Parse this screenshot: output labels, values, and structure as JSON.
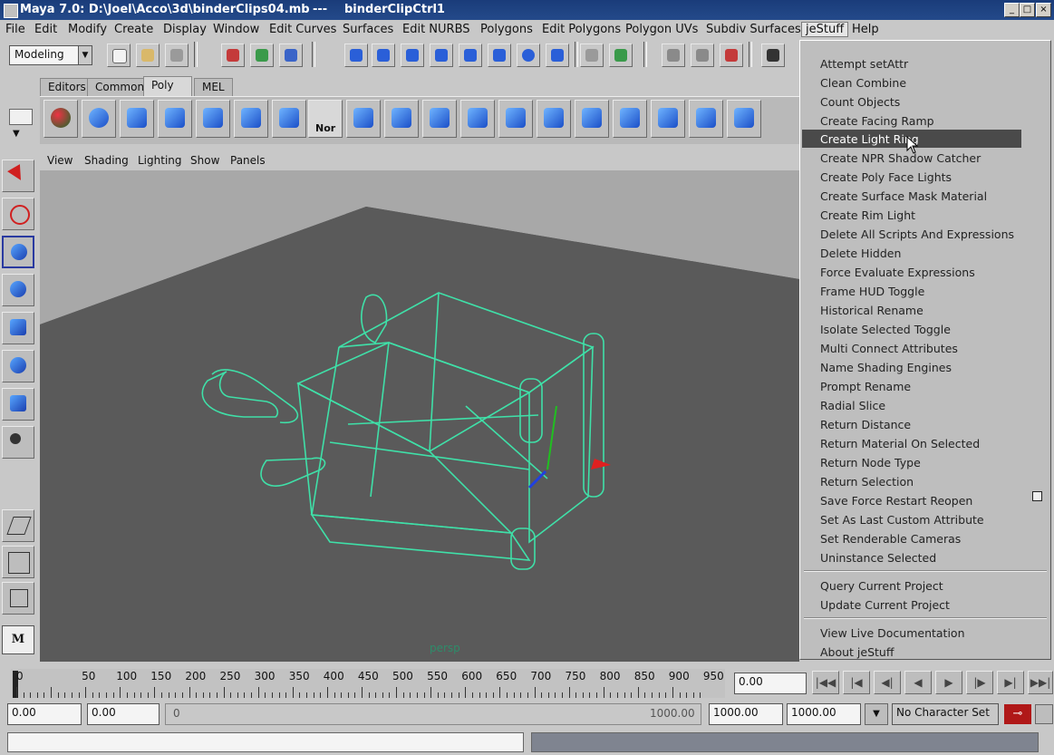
{
  "window": {
    "title": "Maya 7.0: D:\\Joel\\Acco\\3d\\binderClips04.mb",
    "separator": "---",
    "subtitle": "binderClipCtrl1"
  },
  "menubar": [
    "File",
    "Edit",
    "Modify",
    "Create",
    "Display",
    "Window",
    "Edit Curves",
    "Surfaces",
    "Edit NURBS",
    "Polygons",
    "Edit Polygons",
    "Polygon UVs",
    "Subdiv Surfaces",
    "jeStuff",
    "Help"
  ],
  "status": {
    "mode": "Modeling"
  },
  "shelf_tabs": [
    "Editors",
    "Common",
    "Poly",
    "MEL"
  ],
  "shelf_active": "Poly",
  "shelf_nor_label": "Nor",
  "panel_menu": [
    "View",
    "Shading",
    "Lighting",
    "Show",
    "Panels"
  ],
  "viewport": {
    "camera_label": "persp"
  },
  "jestuff_menu": {
    "items_group1": [
      "Attempt setAttr",
      "Clean Combine",
      "Count Objects",
      "Create Facing Ramp",
      "Create Light Ring",
      "Create NPR Shadow Catcher",
      "Create Poly Face Lights",
      "Create Surface Mask Material",
      "Create Rim Light",
      "Delete All Scripts And Expressions",
      "Delete Hidden",
      "Force Evaluate Expressions",
      "Frame HUD Toggle",
      "Historical Rename",
      "Isolate Selected Toggle",
      "Multi Connect Attributes",
      "Name Shading Engines",
      "Prompt Rename",
      "Radial Slice",
      "Return Distance",
      "Return Material On Selected",
      "Return Node Type",
      "Return Selection",
      "Save Force Restart Reopen",
      "Set As Last Custom Attribute",
      "Set Renderable Cameras",
      "Uninstance Selected"
    ],
    "items_group2": [
      "Query Current Project",
      "Update Current Project"
    ],
    "items_group3": [
      "View Live Documentation",
      "About jeStuff"
    ],
    "highlighted": "Create Light Ring"
  },
  "timeline": {
    "ticks": [
      "0",
      "50",
      "100",
      "150",
      "200",
      "250",
      "300",
      "350",
      "400",
      "450",
      "500",
      "550",
      "600",
      "650",
      "700",
      "750",
      "800",
      "850",
      "900",
      "950"
    ],
    "current_time": "0.00"
  },
  "range": {
    "start": "0.00",
    "playback_start": "0.00",
    "slider_start": "0",
    "slider_end": "1000.00",
    "playback_end": "1000.00",
    "end": "1000.00",
    "character_set": "No Character Set"
  },
  "colors": {
    "titlebar": "#244a8a",
    "viewport_bg": "#5c5c5c",
    "wireframe": "#3fe0a8",
    "menu_highlight": "#4a4a4a"
  }
}
